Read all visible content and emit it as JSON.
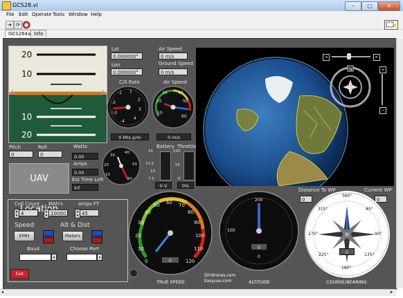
{
  "window": {
    "title": "GCS28.vi"
  },
  "menu": {
    "items": [
      "File",
      "Edit",
      "Operate",
      "Tools",
      "Window",
      "Help"
    ]
  },
  "tabs": [
    "GCS264a",
    "Info"
  ],
  "position": {
    "lat_label": "Lat",
    "lat_value": "0.000000°",
    "lon_label": "Lon",
    "lon_value": "0.000000°"
  },
  "speeds": {
    "air_speed_label": "Air Speed",
    "air_speed_value": "0 m/s",
    "ground_speed_label": "Ground Speed",
    "ground_speed_value": "0 m/s"
  },
  "horizon": {
    "scale_top": [
      "20",
      "10"
    ],
    "scale_bottom": [
      "10",
      "20"
    ],
    "pitch_label": "Pitch",
    "roll_label": "Roll",
    "pitch_value": "0",
    "roll_value": "0"
  },
  "climb_gauge": {
    "title": "C/S Rate",
    "ticks": [
      "1",
      "2",
      "3",
      "-1",
      "-2",
      "-3",
      "-4",
      "4",
      "0"
    ],
    "readout": "0 Mts p/m"
  },
  "airspeed_gauge": {
    "title": "Air Speed",
    "ticks": [
      "10",
      "20",
      "30",
      "40",
      "50",
      "60"
    ],
    "readout": "0 m/s"
  },
  "power": {
    "watts_label": "Watts",
    "watts_value": "0.00",
    "amps_label": "Amps",
    "amps_value": "0.00",
    "time_label": "Est Time Left",
    "time_value": "Inf"
  },
  "power_gauge": {
    "ticks": [
      "10",
      "20",
      "30",
      "40",
      "50",
      "60"
    ]
  },
  "battery": {
    "label": "Battery",
    "ticks": [
      "15",
      "12.5",
      "10",
      "7.5"
    ],
    "readout": "0 V"
  },
  "throttle": {
    "label": "Throttle",
    "ticks": [
      "100",
      "50",
      "0"
    ],
    "readout": "0%"
  },
  "uav_location_label": "UAV Location",
  "settings": {
    "cell_count_label": "Cell Count",
    "cell_count_value": "4",
    "mah_label": "MAh's",
    "mah_value": "10000",
    "amps_ft_label": "Amps FT",
    "amps_ft_value": "45",
    "speed_label": "Speed",
    "speed_button": "KMH",
    "alt_dist_label": "Alt & Dist",
    "alt_button": "Meters",
    "baud_label": "Baud",
    "baud_value": "",
    "port_label": "Choose Port",
    "port_value": "",
    "exit_label": "Exit"
  },
  "true_speed": {
    "label": "TRUE SPEED",
    "ticks": [
      "0",
      "10",
      "20",
      "30",
      "40",
      "50",
      "60",
      "70",
      "80",
      "90",
      "100",
      "110",
      "120"
    ],
    "readout": "0"
  },
  "altitude": {
    "label": "ALTITUDE",
    "ticks": [
      "200",
      "100",
      "0"
    ],
    "readout": "0"
  },
  "wp": {
    "distance_label": "Distance To WP",
    "distance_value": "0",
    "current_label": "Current WP",
    "current_value": "0"
  },
  "compass": {
    "label": "COURSE/BEARING",
    "ticks": [
      "360°",
      "45°",
      "90°",
      "135°",
      "180°",
      "225°",
      "270°",
      "315°"
    ],
    "readout": "0"
  },
  "credits": {
    "line1": "DIYdrones.com",
    "line2": "Easyuav.com"
  },
  "colors": {
    "panel": "#555555",
    "uav_button": "#8a8a8a",
    "needle_red": "#d61f1f",
    "needle_blue": "#2f6fe0",
    "exit": "#c6232a"
  }
}
